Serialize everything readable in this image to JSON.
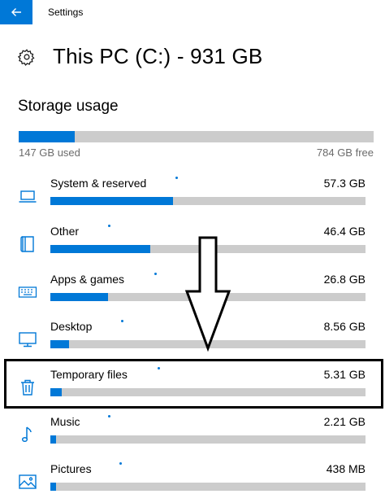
{
  "window": {
    "title": "Settings"
  },
  "header": {
    "title": "This PC (C:) - 931 GB"
  },
  "section": {
    "title": "Storage usage"
  },
  "overall": {
    "used_label": "147 GB used",
    "free_label": "784 GB free",
    "used_fraction": 0.158
  },
  "categories": [
    {
      "name": "System & reserved",
      "size": "57.3 GB",
      "fraction": 0.39,
      "icon": "laptop-icon"
    },
    {
      "name": "Other",
      "size": "46.4 GB",
      "fraction": 0.316,
      "icon": "phone-book-icon"
    },
    {
      "name": "Apps & games",
      "size": "26.8 GB",
      "fraction": 0.183,
      "icon": "keyboard-icon"
    },
    {
      "name": "Desktop",
      "size": "8.56 GB",
      "fraction": 0.06,
      "icon": "monitor-icon"
    },
    {
      "name": "Temporary files",
      "size": "5.31 GB",
      "fraction": 0.036,
      "icon": "trash-icon"
    },
    {
      "name": "Music",
      "size": "2.21 GB",
      "fraction": 0.015,
      "icon": "music-note-icon"
    },
    {
      "name": "Pictures",
      "size": "438 MB",
      "fraction": 0.004,
      "icon": "picture-icon"
    }
  ],
  "colors": {
    "accent": "#0078d7",
    "track": "#cccccc",
    "annotation": "#000000"
  }
}
